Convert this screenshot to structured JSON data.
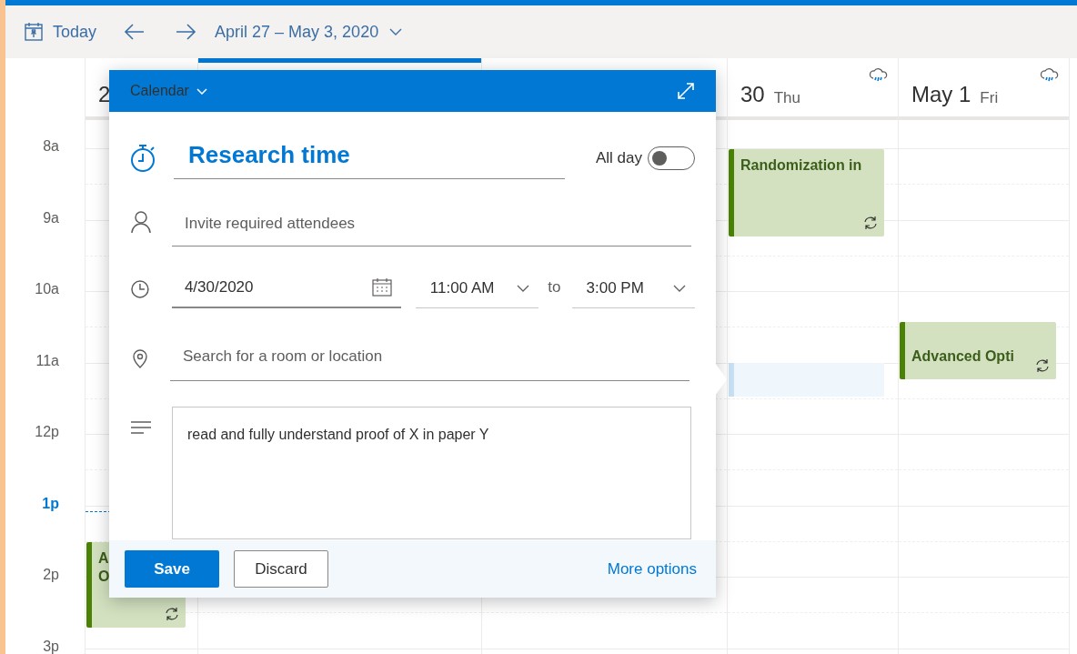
{
  "toolbar": {
    "today": "Today",
    "range": "April 27 – May 3, 2020"
  },
  "hours": [
    {
      "label": "8a",
      "current": false
    },
    {
      "label": "9a",
      "current": false
    },
    {
      "label": "10a",
      "current": false
    },
    {
      "label": "11a",
      "current": false
    },
    {
      "label": "12p",
      "current": false
    },
    {
      "label": "1p",
      "current": true
    },
    {
      "label": "2p",
      "current": false
    },
    {
      "label": "3p",
      "current": false
    }
  ],
  "columns": [
    {
      "number": "2",
      "today": false,
      "events": [
        {
          "lines": [
            "A",
            "O"
          ],
          "recurring": true
        }
      ]
    },
    {
      "today": true
    },
    {
      "today": false
    },
    {
      "number": "30",
      "weekday": "Thu",
      "rain_forecast": true,
      "today": false,
      "events": [
        {
          "lines": [
            "Randomization in"
          ],
          "recurring": true
        }
      ]
    },
    {
      "number": "May 1",
      "weekday": "Fri",
      "rain_forecast": true,
      "today": false,
      "events": [
        {
          "lines": [
            "Advanced Opti"
          ],
          "recurring": true
        }
      ]
    }
  ],
  "popup": {
    "calendar": "Calendar",
    "title": "Research time",
    "all_day": {
      "label": "All day",
      "on": false
    },
    "attendees": {
      "placeholder": "Invite required attendees"
    },
    "date": "4/30/2020",
    "start": "11:00 AM",
    "to": "to",
    "end": "3:00 PM",
    "location": {
      "placeholder": "Search for a room or location"
    },
    "notes": "read and fully understand proof of X in paper Y",
    "buttons": [
      {
        "label": "Save",
        "primary": true
      },
      {
        "label": "Discard",
        "primary": false
      }
    ],
    "more": "More options"
  }
}
